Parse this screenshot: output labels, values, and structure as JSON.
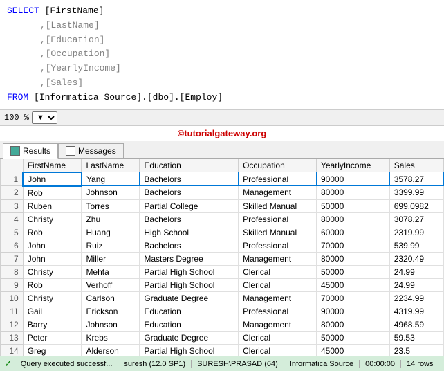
{
  "editor": {
    "lines": [
      {
        "indent": 0,
        "content": [
          {
            "type": "keyword",
            "text": "SELECT"
          },
          {
            "type": "space",
            "text": " "
          },
          {
            "type": "bracket",
            "text": "["
          },
          {
            "type": "field",
            "text": "FirstName"
          },
          {
            "type": "bracket",
            "text": "]"
          }
        ]
      },
      {
        "indent": 1,
        "content": [
          {
            "type": "bracket",
            "text": ","
          },
          {
            "type": "bracket",
            "text": "["
          },
          {
            "type": "field",
            "text": "LastName"
          },
          {
            "type": "bracket",
            "text": "]"
          }
        ]
      },
      {
        "indent": 1,
        "content": [
          {
            "type": "bracket",
            "text": ","
          },
          {
            "type": "bracket",
            "text": "["
          },
          {
            "type": "field",
            "text": "Education"
          },
          {
            "type": "bracket",
            "text": "]"
          }
        ]
      },
      {
        "indent": 1,
        "content": [
          {
            "type": "bracket",
            "text": ","
          },
          {
            "type": "bracket",
            "text": "["
          },
          {
            "type": "field",
            "text": "Occupation"
          },
          {
            "type": "bracket",
            "text": "]"
          }
        ]
      },
      {
        "indent": 1,
        "content": [
          {
            "type": "bracket",
            "text": ","
          },
          {
            "type": "bracket",
            "text": "["
          },
          {
            "type": "field",
            "text": "YearlyIncome"
          },
          {
            "type": "bracket",
            "text": "]"
          }
        ]
      },
      {
        "indent": 1,
        "content": [
          {
            "type": "bracket",
            "text": ","
          },
          {
            "type": "bracket",
            "text": "["
          },
          {
            "type": "field",
            "text": "Sales"
          },
          {
            "type": "bracket",
            "text": "]"
          }
        ]
      },
      {
        "indent": 0,
        "content": [
          {
            "type": "keyword",
            "text": "      FROM"
          },
          {
            "type": "space",
            "text": " "
          },
          {
            "type": "bracket",
            "text": "["
          },
          {
            "type": "field",
            "text": "Informatica Source"
          },
          {
            "type": "bracket",
            "text": "]"
          },
          {
            "type": "field",
            "text": "."
          },
          {
            "type": "bracket",
            "text": "["
          },
          {
            "type": "field",
            "text": "dbo"
          },
          {
            "type": "bracket",
            "text": "]"
          },
          {
            "type": "field",
            "text": "."
          },
          {
            "type": "bracket",
            "text": "["
          },
          {
            "type": "field",
            "text": "Employ"
          },
          {
            "type": "bracket",
            "text": "]"
          }
        ]
      }
    ]
  },
  "toolbar": {
    "zoom": "100 %"
  },
  "watermark": "©tutorialgateway.org",
  "tabs": [
    {
      "label": "Results",
      "active": true,
      "icon": "grid"
    },
    {
      "label": "Messages",
      "active": false,
      "icon": "message"
    }
  ],
  "table": {
    "columns": [
      "",
      "FirstName",
      "LastName",
      "Education",
      "Occupation",
      "YearlyIncome",
      "Sales"
    ],
    "rows": [
      {
        "num": "1",
        "firstName": "John",
        "lastName": "Yang",
        "education": "Bachelors",
        "occupation": "Professional",
        "yearlyIncome": "90000",
        "sales": "3578.27",
        "highlight": true
      },
      {
        "num": "2",
        "firstName": "Rob",
        "lastName": "Johnson",
        "education": "Bachelors",
        "occupation": "Management",
        "yearlyIncome": "80000",
        "sales": "3399.99",
        "highlight": false
      },
      {
        "num": "3",
        "firstName": "Ruben",
        "lastName": "Torres",
        "education": "Partial College",
        "occupation": "Skilled Manual",
        "yearlyIncome": "50000",
        "sales": "699.0982",
        "highlight": false
      },
      {
        "num": "4",
        "firstName": "Christy",
        "lastName": "Zhu",
        "education": "Bachelors",
        "occupation": "Professional",
        "yearlyIncome": "80000",
        "sales": "3078.27",
        "highlight": false
      },
      {
        "num": "5",
        "firstName": "Rob",
        "lastName": "Huang",
        "education": "High School",
        "occupation": "Skilled Manual",
        "yearlyIncome": "60000",
        "sales": "2319.99",
        "highlight": false
      },
      {
        "num": "6",
        "firstName": "John",
        "lastName": "Ruiz",
        "education": "Bachelors",
        "occupation": "Professional",
        "yearlyIncome": "70000",
        "sales": "539.99",
        "highlight": false
      },
      {
        "num": "7",
        "firstName": "John",
        "lastName": "Miller",
        "education": "Masters Degree",
        "occupation": "Management",
        "yearlyIncome": "80000",
        "sales": "2320.49",
        "highlight": false
      },
      {
        "num": "8",
        "firstName": "Christy",
        "lastName": "Mehta",
        "education": "Partial High School",
        "occupation": "Clerical",
        "yearlyIncome": "50000",
        "sales": "24.99",
        "highlight": false
      },
      {
        "num": "9",
        "firstName": "Rob",
        "lastName": "Verhoff",
        "education": "Partial High School",
        "occupation": "Clerical",
        "yearlyIncome": "45000",
        "sales": "24.99",
        "highlight": false
      },
      {
        "num": "10",
        "firstName": "Christy",
        "lastName": "Carlson",
        "education": "Graduate Degree",
        "occupation": "Management",
        "yearlyIncome": "70000",
        "sales": "2234.99",
        "highlight": false
      },
      {
        "num": "11",
        "firstName": "Gail",
        "lastName": "Erickson",
        "education": "Education",
        "occupation": "Professional",
        "yearlyIncome": "90000",
        "sales": "4319.99",
        "highlight": false
      },
      {
        "num": "12",
        "firstName": "Barry",
        "lastName": "Johnson",
        "education": "Education",
        "occupation": "Management",
        "yearlyIncome": "80000",
        "sales": "4968.59",
        "highlight": false
      },
      {
        "num": "13",
        "firstName": "Peter",
        "lastName": "Krebs",
        "education": "Graduate Degree",
        "occupation": "Clerical",
        "yearlyIncome": "50000",
        "sales": "59.53",
        "highlight": false
      },
      {
        "num": "14",
        "firstName": "Greg",
        "lastName": "Alderson",
        "education": "Partial High School",
        "occupation": "Clerical",
        "yearlyIncome": "45000",
        "sales": "23.5",
        "highlight": false
      }
    ]
  },
  "statusBar": {
    "message": "Query executed successf...",
    "user": "suresh (12.0 SP1)",
    "server": "SURESH\\PRASAD (64)",
    "database": "Informatica Source",
    "time": "00:00:00",
    "rows": "14 rows"
  }
}
